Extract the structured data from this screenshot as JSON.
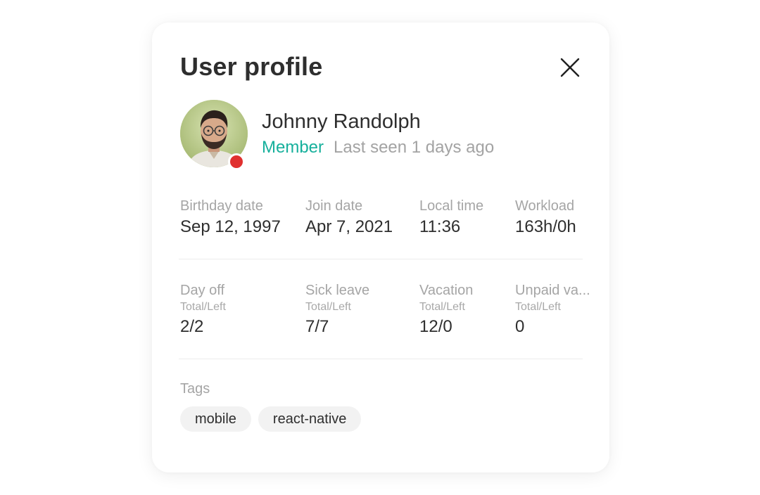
{
  "dialog": {
    "title": "User profile"
  },
  "user": {
    "name": "Johnny Randolph",
    "role": "Member",
    "last_seen": "Last seen 1 days ago",
    "status_color": "#e0302f",
    "role_color": "#17b09c"
  },
  "details": [
    {
      "label": "Birthday date",
      "value": "Sep 12, 1997"
    },
    {
      "label": "Join date",
      "value": "Apr 7, 2021"
    },
    {
      "label": "Local time",
      "value": "11:36"
    },
    {
      "label": "Workload",
      "value": "163h/0h"
    }
  ],
  "leaves": [
    {
      "label": "Day off",
      "sublabel": "Total/Left",
      "value": "2/2"
    },
    {
      "label": "Sick leave",
      "sublabel": "Total/Left",
      "value": "7/7"
    },
    {
      "label": "Vacation",
      "sublabel": "Total/Left",
      "value": "12/0"
    },
    {
      "label": "Unpaid va...",
      "sublabel": "Total/Left",
      "value": "0"
    }
  ],
  "tags": {
    "label": "Tags",
    "items": [
      "mobile",
      "react-native"
    ]
  },
  "icons": {
    "close": "close-icon",
    "avatar": "avatar-photo",
    "status": "status-dot"
  }
}
